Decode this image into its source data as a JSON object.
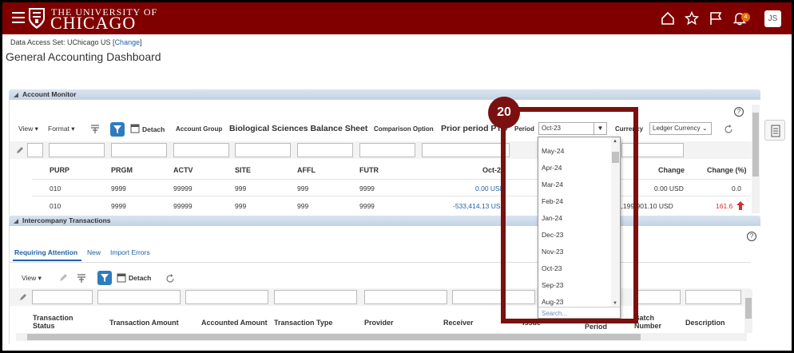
{
  "brand": {
    "line1": "THE UNIVERSITY OF",
    "line2": "CHICAGO"
  },
  "header": {
    "notification_count": "4",
    "avatar_initials": "JS"
  },
  "data_access": {
    "label": "Data Access Set: UChicago US [",
    "link": "Change",
    "close": "]"
  },
  "page_title": "General Accounting Dashboard",
  "account_monitor": {
    "title": "Account Monitor",
    "view_label": "View",
    "format_label": "Format",
    "detach_label": "Detach",
    "account_group_label": "Account Group",
    "account_group_value": "Biological Sciences Balance Sheet",
    "comparison_label": "Comparison Option",
    "comparison_value": "Prior period PTD",
    "period_label": "Period",
    "period_value": "Oct-23",
    "currency_label": "Currency",
    "currency_value": "Ledger Currency",
    "columns": {
      "purp": "PURP",
      "prgm": "PRGM",
      "actv": "ACTV",
      "site": "SITE",
      "affl": "AFFL",
      "futr": "FUTR",
      "oct": "Oct-23",
      "change": "Change",
      "change_pct": "Change (%)"
    },
    "rows": [
      {
        "purp": "010",
        "prgm": "9999",
        "actv": "99999",
        "site": "999",
        "affl": "999",
        "futr": "9999",
        "oct": "0.00 USD",
        "change": "0.00 USD",
        "change_pct": "0.0"
      },
      {
        "purp": "010",
        "prgm": "9999",
        "actv": "99999",
        "site": "999",
        "affl": "999",
        "futr": "9999",
        "oct": "-533,414.13 USD",
        "change": "-1,199,901.10 USD",
        "change_pct": "161.6"
      }
    ]
  },
  "intercompany": {
    "title": "Intercompany Transactions",
    "tabs": [
      "Requiring Attention",
      "New",
      "Import Errors"
    ],
    "view_label": "View",
    "detach_label": "Detach",
    "columns": {
      "status": "Transaction Status",
      "amount": "Transaction Amount",
      "accounted": "Accounted Amount",
      "type": "Transaction Type",
      "provider": "Provider",
      "receiver": "Receiver",
      "issue": "Issue",
      "period": "Period",
      "batch": "Batch Number",
      "description": "Description"
    }
  },
  "period_dropdown": {
    "options": [
      "May-24",
      "Apr-24",
      "Mar-24",
      "Feb-24",
      "Jan-24",
      "Dec-23",
      "Nov-23",
      "Oct-23",
      "Sep-23",
      "Aug-23"
    ],
    "search_placeholder": "Search..."
  },
  "annotation": {
    "step": "20"
  },
  "colors": {
    "brand": "#800000",
    "link": "#1f5fa5",
    "annotation": "#7a1010",
    "badge": "#e57300"
  }
}
